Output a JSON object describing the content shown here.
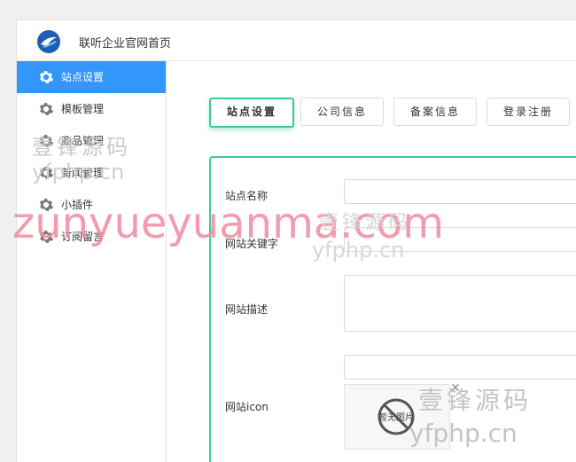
{
  "header": {
    "site_title": "联听企业官网首页",
    "logo_icon": "bird-logo-icon"
  },
  "sidebar": {
    "items": [
      {
        "label": "站点设置",
        "icon": "gear-icon",
        "active": true
      },
      {
        "label": "模板管理",
        "icon": "gear-icon"
      },
      {
        "label": "商品管理",
        "icon": "gear-icon"
      },
      {
        "label": "新闻管理",
        "icon": "gear-icon"
      },
      {
        "label": "小插件",
        "icon": "gear-icon"
      },
      {
        "label": "订阅留言",
        "icon": "gear-icon"
      }
    ]
  },
  "tabs": [
    {
      "label": "站点设置",
      "active": true
    },
    {
      "label": "公司信息"
    },
    {
      "label": "备案信息"
    },
    {
      "label": "登录注册"
    }
  ],
  "form": {
    "site_name_label": "站点名称",
    "site_keywords_label": "网站关键字",
    "site_description_label": "网站描述",
    "site_icon_label": "网站icon",
    "no_image_text": "暂无图片",
    "remove_icon": "✕"
  },
  "watermarks": {
    "cn_brand": "壹锋源码",
    "domain": "yfphp.cn",
    "big_text": "zunyueyuanma.com"
  },
  "colors": {
    "accent_blue": "#3296fa",
    "accent_green": "#3dcc8e",
    "watermark_pink": "#f08aa0"
  }
}
